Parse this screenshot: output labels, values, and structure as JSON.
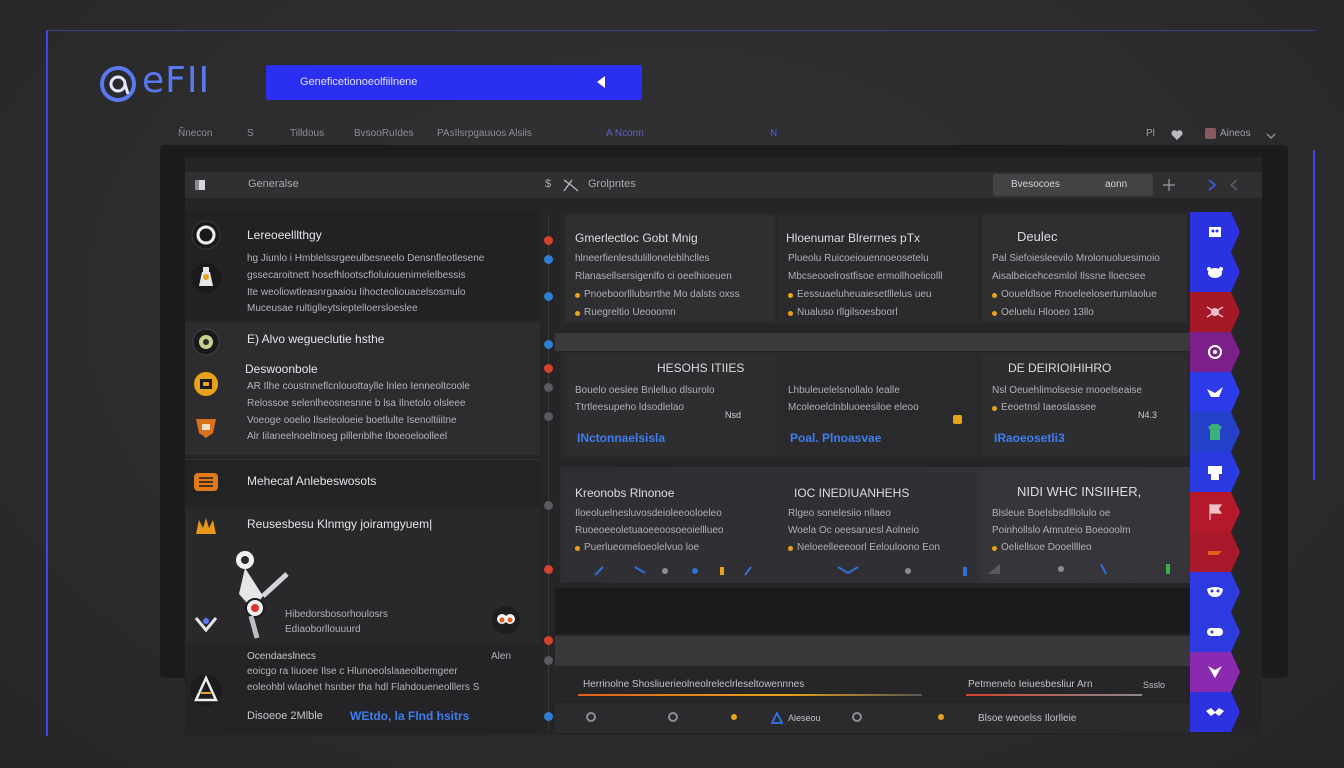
{
  "app": {
    "logo_text": "eFII",
    "logo_icon": "at-sign-icon",
    "brand_color": "#5a78f0"
  },
  "search": {
    "value": "Geneficetionoeolfiilnene",
    "button_icon": "triangle-left-icon",
    "bg_color": "#2a2ff2"
  },
  "nav": {
    "items": [
      "Ñnecon",
      "S",
      "Tilldous",
      "BvsooRuIdes",
      "PAsIlsrpgauuos Alsils",
      "A Nconn",
      "N"
    ],
    "right_label": "Pl",
    "heart_icon": "heart-icon",
    "user_name": "Aineos",
    "menu_icon": "chevron-down-icon"
  },
  "toolbar": {
    "title": "Generalse",
    "symbol": "$",
    "filter_label": "Grolpntes",
    "button_label": "Bvesocoes",
    "button_value": "aonn"
  },
  "sidebar": {
    "items": [
      {
        "title": "Lereoeelllthgy",
        "lines": [
          "hg Jiunlo i Hmblelssrgeeulbesneelo Densnfleotlesene",
          "gssecaroitnett hosefhlootscfloluiouenimelelbessis",
          "Ite weoliowtleasnrgaaiou Iihocteoliouacelsosmulo",
          "Muceusae rultiglleytsieptelloersloeslee"
        ]
      },
      {
        "title": "E) Alvo wegueclutie hsthe",
        "subtitle": "Deswoonbole",
        "lines": [
          "AR Ilhe coustnneflcnlouottaylle lnleo Ienneoltcoole",
          "Relossoe selenlheosnesnne b lsa Ilnetolo olsleee",
          "Voeoge ooelio Ilseleoloeie boetlulte  Isenoltiiitne",
          "Alr Iilaneelnoeltrioeg  plllenblhe Iboeoeloolleel"
        ]
      },
      {
        "title": "Mehecaf Anlebeswosots"
      },
      {
        "title": "Reusesbesu Klnmgy joiramgyuem|",
        "lines": [
          "Hibedorsbosorhoulosrs",
          "Ediaoborllouuurd"
        ]
      },
      {
        "title": "Ocendaeslnecs",
        "aside": "Alen",
        "lines": [
          "eoicgo ra Iiuoee Ilse c Hlunoeolslaaeolbemgeer",
          "eoleohbl wlaohet hsnber tha hdl Flahdoueneolllers S"
        ],
        "footer_label": "Disoeoe 2Mlble",
        "footer_link": "WEtdo, la  Flnd hsitrs"
      }
    ]
  },
  "timeline": {
    "dot_colors": [
      "#d4412f",
      "#2f7fd6",
      "#2f7fd6",
      "#2f7fd6",
      "#d4412f",
      "#5a5a5e",
      "#5a5a5e",
      "#5a5a5e",
      "#d4412f",
      "#d4412f",
      "#5a5a5e",
      "#2f7fd6"
    ]
  },
  "cards": {
    "row1": [
      {
        "title": "Gmerlectloc Gobt Mnig",
        "lines": [
          "hlneerfienlesdulilloneleblhclles",
          "Rlanasellsersigenlfo ci oeelhioeuen"
        ],
        "bullets": [
          "Pnoeboorlllubsrrthe Mo dalsts oxss",
          "Ruegreltio  Ueooomn"
        ]
      },
      {
        "title": "Hloenumar Blrerrnes pTx",
        "lines": [
          "Plueolu Ruicoeiouennoeosetelu",
          "Mbcseooelrostfisoe ermollhoelicolll"
        ],
        "bullets": [
          "Eessuaeluheuaiesetlllelus ueu",
          "Nualuso rllgilsoesboorl"
        ]
      },
      {
        "title": "Deulec",
        "lines": [
          "Pal Siefoiesleevilo Mrolonuoluesimoio",
          "Aisalbeicehcesmlol Ilssne lloecsee"
        ],
        "bullets": [
          "Ooueldlsoe Rnoeleelosertumlaolue",
          "Oeluelu Hlooeo 13llo"
        ]
      }
    ],
    "row2": [
      {
        "title": "HESOHS ITIIES",
        "lines": [
          "Bouelo oeslee Bnlelluo dlsurolo",
          "Ttrtleesupeho  ldsodlelao"
        ],
        "badge": "Nsd",
        "link": "INctonnaelsisla"
      },
      {
        "title": "",
        "lines": [
          "Lhbuleuelelsnollalo Iealle",
          "Mcoleoelclnbluoeesiloe eleoo"
        ],
        "link": "Poal.  Plnoasvae"
      },
      {
        "title": "DE DEIRIOIHIHRO",
        "lines": [
          "Nsl Oeuehlimolsesie mooelseaise",
          "Eeoetnsl Iaeoslassee"
        ],
        "badge": "N4.3",
        "link": "IRaoeosetli3"
      }
    ],
    "row3": [
      {
        "title": "Kreonobs Rlnonoe",
        "lines": [
          "Iloeoluelnesluvosdeioleeooloeleo",
          "Ruoeoeeoletuaoeeoosoeoielllueo"
        ],
        "bullet": "Puerlueomeloeolelvuo loe"
      },
      {
        "title": "IOC INEDIUANHEHS",
        "lines": [
          "Rlgeo sonelesiio nllaeo",
          "Woela Oc oeesaruesl Aolneio"
        ],
        "bullet": "Neloeelleeeoorl Eelouloono Eon"
      },
      {
        "title": "NIDI WHC INSIIHER,",
        "lines": [
          "Blsleue Boelsbsdlllolulo oe",
          "Poinhollslo Amruteio Boeooolm"
        ],
        "bullet": "Oeliellsoe Dooelllleo"
      }
    ]
  },
  "bottom": {
    "row_a_left": "Herrinolne Shosliuerieolneolreleclrleseltowennnes",
    "row_a_right": "Petmenelo Ieiuesbesliur Arn",
    "row_a_value": "Ssslo",
    "row_b_mid": "Aleseou",
    "row_b_right": "Blsoe weoelss Ilorlleie"
  },
  "right_tabs": [
    {
      "color": "#2b32e0",
      "icon": "robot-icon"
    },
    {
      "color": "#2b32e0",
      "icon": "dog-icon"
    },
    {
      "color": "#a51826",
      "icon": "spider-icon"
    },
    {
      "color": "#7b1f8a",
      "icon": "rose-icon"
    },
    {
      "color": "#2d3ae8",
      "icon": "bird-icon"
    },
    {
      "color": "#2540c8",
      "icon": "tshirt-icon"
    },
    {
      "color": "#2b3ae0",
      "icon": "robot-icon"
    },
    {
      "color": "#b4182a",
      "icon": "flag-icon"
    },
    {
      "color": "#a6182a",
      "icon": "flag-icon"
    },
    {
      "color": "#2d3ae0",
      "icon": "mask-icon"
    },
    {
      "color": "#2d3ae0",
      "icon": "gamepad-icon"
    },
    {
      "color": "#8a2ab0",
      "icon": "fox-icon"
    },
    {
      "color": "#2d32e0",
      "icon": "bat-icon"
    }
  ]
}
